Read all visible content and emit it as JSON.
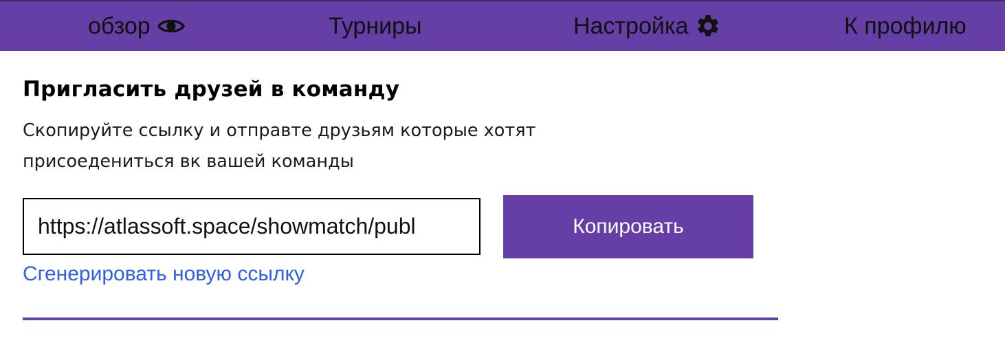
{
  "nav": {
    "overview_label": "обзор",
    "overview_icon": "eye-icon",
    "tournaments_label": "Турниры",
    "settings_label": "Настройка",
    "settings_icon": "gear-icon",
    "profile_label": "К профилю"
  },
  "invite": {
    "title": "Пригласить друзей в команду",
    "description": "Скопируйте ссылку и отправте друзьям которые хотят присоедениться вк вашей команды",
    "link_value": "https://atlassoft.space/showmatch/publ",
    "copy_label": "Копировать",
    "generate_label": "Сгенерировать новую ссылку"
  },
  "colors": {
    "accent": "#653ea6",
    "link": "#2f5ee8",
    "text": "#000000"
  }
}
